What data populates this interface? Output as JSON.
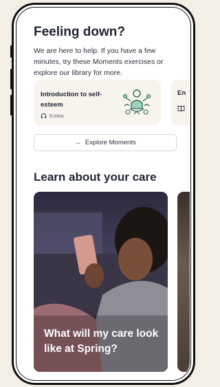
{
  "moments": {
    "heading": "Feeling down?",
    "description": "We are here to help. If you have a few minutes, try these Moments exercises or explore our library for more.",
    "cards": [
      {
        "title": "Introduction to self-esteem",
        "duration": "5 mins",
        "icon": "headphones-icon"
      },
      {
        "title": "En",
        "icon": "book-icon"
      }
    ],
    "explore_button": {
      "arrow": "→",
      "label": "Explore Moments"
    }
  },
  "care": {
    "heading": "Learn about your care",
    "cards": [
      {
        "caption": "What will my care look like at Spring?"
      }
    ]
  },
  "colors": {
    "background": "#f3efe7",
    "heading_text": "#1f2431",
    "card_background": "#f7f4ee",
    "illustration_green": "#2e6b4f"
  }
}
